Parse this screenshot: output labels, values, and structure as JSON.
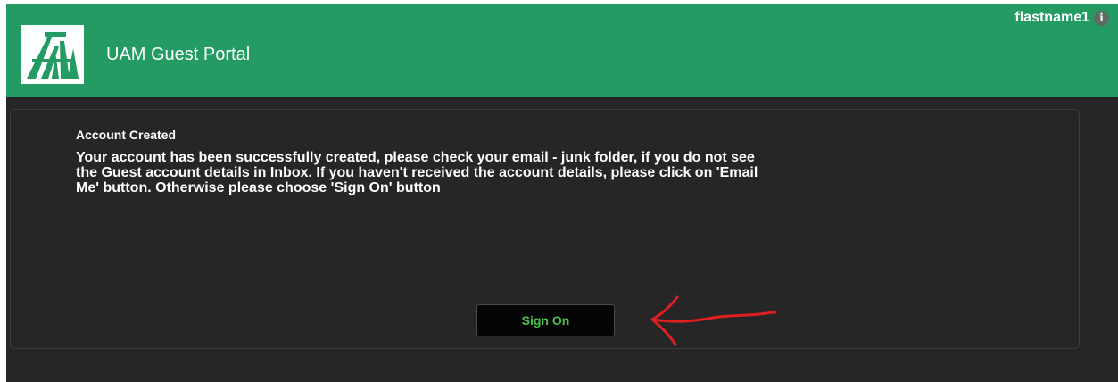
{
  "header": {
    "title": "UAM Guest Portal",
    "username": "flastname1",
    "logo_icon": "uam-logo-icon",
    "info_icon": "info-icon",
    "background_color": "#249b63"
  },
  "panel": {
    "heading": "Account Created",
    "message": "Your account has been successfully created, please check your email - junk folder, if you do not see the Guest account details in Inbox. If you haven't received the account details, please click on 'Email Me' button. Otherwise please choose 'Sign On' button",
    "sign_on_label": "Sign On",
    "background_color": "#262626",
    "button_text_color": "#4cc24c"
  },
  "annotation": {
    "icon": "red-arrow-icon",
    "color": "#e02020"
  }
}
